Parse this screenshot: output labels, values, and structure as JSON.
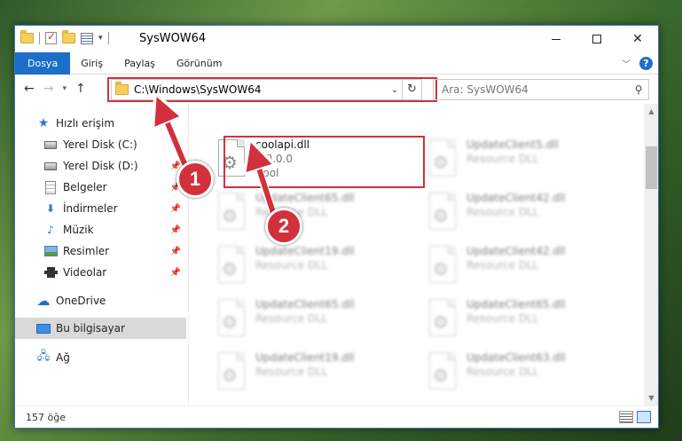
{
  "window": {
    "title": "SysWOW64"
  },
  "ribbon": {
    "tabs": [
      {
        "label": "Dosya",
        "active": true
      },
      {
        "label": "Giriş"
      },
      {
        "label": "Paylaş"
      },
      {
        "label": "Görünüm"
      }
    ],
    "help": "?"
  },
  "nav": {
    "address": "C:\\Windows\\SysWOW64",
    "search_placeholder": "Ara: SysWOW64"
  },
  "sidebar": {
    "items": [
      {
        "label": "Hızlı erişim",
        "icon": "star-icon"
      },
      {
        "label": "Yerel Disk (C:)",
        "icon": "disk-icon"
      },
      {
        "label": "Yerel Disk (D:)",
        "icon": "disk-icon",
        "pinned": true
      },
      {
        "label": "Belgeler",
        "icon": "documents-icon",
        "pinned": true
      },
      {
        "label": "İndirmeler",
        "icon": "downloads-icon",
        "pinned": true
      },
      {
        "label": "Müzik",
        "icon": "music-icon",
        "pinned": true
      },
      {
        "label": "Resimler",
        "icon": "pictures-icon",
        "pinned": true
      },
      {
        "label": "Videolar",
        "icon": "videos-icon",
        "pinned": true
      },
      {
        "label": "OneDrive",
        "icon": "onedrive-icon"
      },
      {
        "label": "Bu bilgisayar",
        "icon": "this-pc-icon",
        "selected": true
      },
      {
        "label": "Ağ",
        "icon": "network-icon"
      }
    ]
  },
  "files": [
    {
      "name": "coolapi.dll",
      "version": "8.0.0.0",
      "desc": "Cool",
      "highlight": true
    },
    {
      "name": "UpdateClient5.dll",
      "desc": "Resource DLL"
    },
    {
      "name": "UpdateClient65.dll",
      "desc": "Resource DLL"
    },
    {
      "name": "UpdateClient42.dll",
      "desc": "Resource DLL"
    },
    {
      "name": "UpdateClient19.dll",
      "desc": "Resource DLL"
    },
    {
      "name": "UpdateClient42.dll",
      "desc": "Resource DLL"
    },
    {
      "name": "UpdateClient65.dll",
      "desc": "Resource DLL"
    },
    {
      "name": "UpdateClient65.dll",
      "desc": "Resource DLL"
    },
    {
      "name": "UpdateClient19.dll",
      "desc": "Resource DLL"
    },
    {
      "name": "UpdateClient63.dll",
      "desc": "Resource DLL"
    }
  ],
  "status": {
    "count": "157 öğe"
  },
  "annotations": {
    "badge1": "1",
    "badge2": "2",
    "color": "#d3303d"
  }
}
